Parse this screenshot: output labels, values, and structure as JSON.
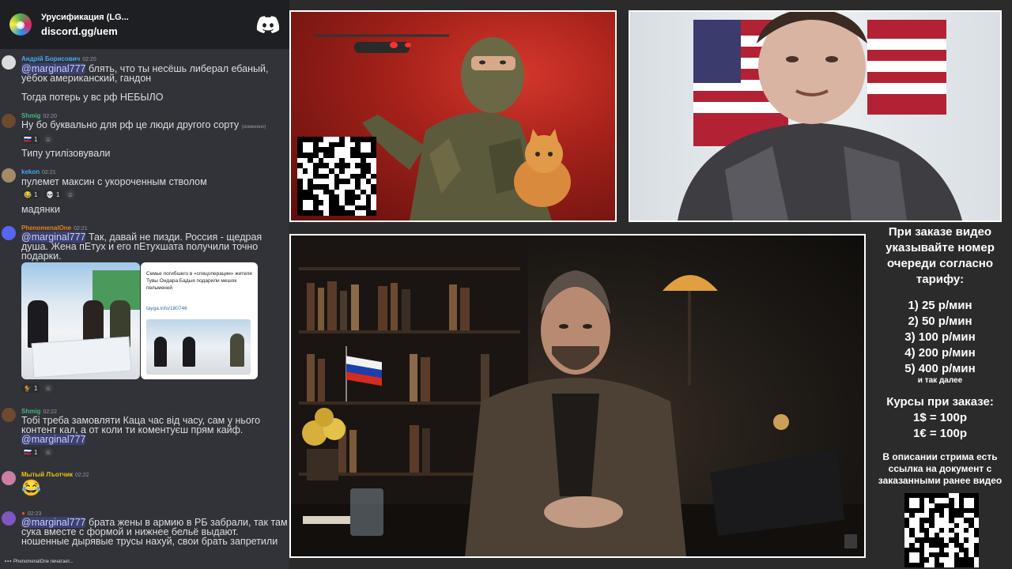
{
  "chat": {
    "server_name": "Урусификация (LG...",
    "invite": "discord.gg/uem",
    "typing_user": "PhenomenalOne",
    "typing_suffix": "печатает...",
    "messages": [
      {
        "user": "Андрій Борисович",
        "time": "02:20",
        "user_color": "#3fa9f5",
        "mention": "@marginal777",
        "text": " блять, что ты несёшь либерал ебаный, уёбок американский, гандон",
        "followup": "Тогда потерь у вс рф НЕБЫЛО"
      },
      {
        "user": "Shmig",
        "time": "02:20",
        "user_color": "#43b581",
        "text": "Ну бо буквально для рф це люди другого сорту",
        "edited": "(изменено)",
        "reactions": [
          {
            "emoji": "🇷🇺",
            "count": "1"
          }
        ],
        "followup": "Типу утилізовували"
      },
      {
        "user": "kekon",
        "time": "02:21",
        "user_color": "#3fa9f5",
        "text": "пулемет максин с укороченным стволом",
        "reactions": [
          {
            "emoji": "😂",
            "count": "1"
          },
          {
            "emoji": "💀",
            "count": "1"
          }
        ],
        "followup": "мадянки"
      },
      {
        "user": "PhenomenalOne",
        "time": "02:21",
        "user_color": "#e67e22",
        "mention": "@marginal777",
        "text": " Так, давай не пизди. Россия - щедрая душа. Жена пЕтух и его пЕтухшата получили точно подарки.",
        "reactions": [
          {
            "emoji": "🐓",
            "count": "1"
          }
        ]
      },
      {
        "user": "Shmig",
        "time": "02:22",
        "user_color": "#43b581",
        "text": "Тобі треба замовляти Каца час від часу, сам у нього контент кал, а от коли ти коментуєш прям кайф.",
        "mention2": "@marginal777",
        "reactions": [
          {
            "emoji": "🇷🇺",
            "count": "1"
          }
        ]
      },
      {
        "user": "Мытый Лъотчик",
        "time": "02:22",
        "user_color": "#f1c40f",
        "emoji_only": "😂"
      },
      {
        "user": "",
        "time": "02:23",
        "user_color": "#e74c3c",
        "mention": "@marginal777",
        "text": " брата жены в армию в РБ забрали, так там сука вместе с формой и нижнее бельё выдают. ношенные дырявые трусы нахуй, свои брать запретили"
      }
    ],
    "embed": {
      "card_text": "Семье погибшего в «спецоперации» жителя Тувы Ондара Бадыя подарили мешок пельменей",
      "card_link": "tayga.info/180746"
    }
  },
  "info": {
    "title": "При заказе видео указывайте номер очереди согласно тарифу:",
    "tariffs": [
      "1) 25 р/мин",
      "2) 50 р/мин",
      "3) 100 р/мин",
      "4) 200 р/мин",
      "5) 400 р/мин"
    ],
    "and_so_on": "и так далее",
    "rates_title": "Курсы при заказе:",
    "rates": [
      "1$ = 100р",
      "1€ = 100р"
    ],
    "desc_note": "В описании стрима есть ссылка на документ с заказанными ранее видео"
  },
  "colors": {
    "chat_bg": "#313338",
    "chat_header_bg": "#1e1f22",
    "mention_fg": "#c9cdfb",
    "page_bg": "#2b2b2b"
  }
}
